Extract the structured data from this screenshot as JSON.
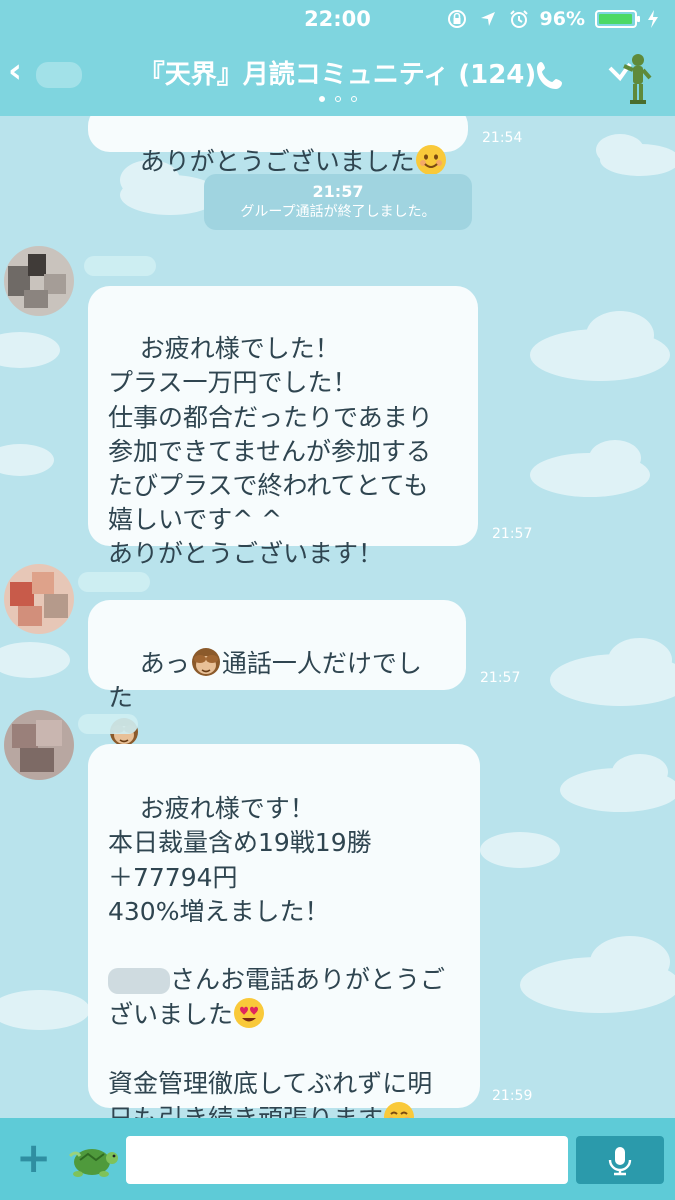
{
  "status_bar": {
    "time": "22:00",
    "battery_percent": "96%",
    "battery_level": 0.96
  },
  "header": {
    "back_icon": "chevron-left-icon",
    "title": "『天界』月読コミュニティ (124)",
    "page_indicator": {
      "count": 3,
      "active": 0
    },
    "call_icon": "phone-icon",
    "menu_icon": "toy-figure-icon"
  },
  "messages": [
    {
      "id": "m0",
      "text": "ありがとうございました",
      "emoji": "smiling-face-emoji",
      "time": "21:54"
    },
    {
      "id": "system",
      "time": "21:57",
      "text": "グループ通話が終了しました。"
    },
    {
      "id": "m1",
      "text": "お疲れ様でした！\nプラス一万円でした！\n仕事の都合だったりであまり\n参加できてませんが参加する\nたびプラスで終われてとても\n嬉しいです^ ^\nありがとうございます！",
      "time": "21:57"
    },
    {
      "id": "m2",
      "text_a": "あっ",
      "emoji_a": "see-no-evil-monkey-emoji",
      "text_b": "通話一人だけでした",
      "emoji_b": "see-no-evil-monkey-emoji",
      "time": "21:57"
    },
    {
      "id": "m3",
      "text_1": "お疲れ様です！\n本日裁量含め19戦19勝\n＋77794円\n430%増えました！\n\n",
      "text_2": "さんお電話ありがとうご\nざいました",
      "emoji_2": "heart-eyes-emoji",
      "text_3": "\n\n資金管理徹底してぶれずに明\n日も引き続き頑張ります",
      "emoji_3": "smiling-face-emoji",
      "time": "21:59"
    }
  ],
  "input_bar": {
    "plus_icon": "plus-icon",
    "sticker_icon": "turtle-sticker-icon",
    "placeholder": "",
    "mic_icon": "microphone-icon"
  }
}
